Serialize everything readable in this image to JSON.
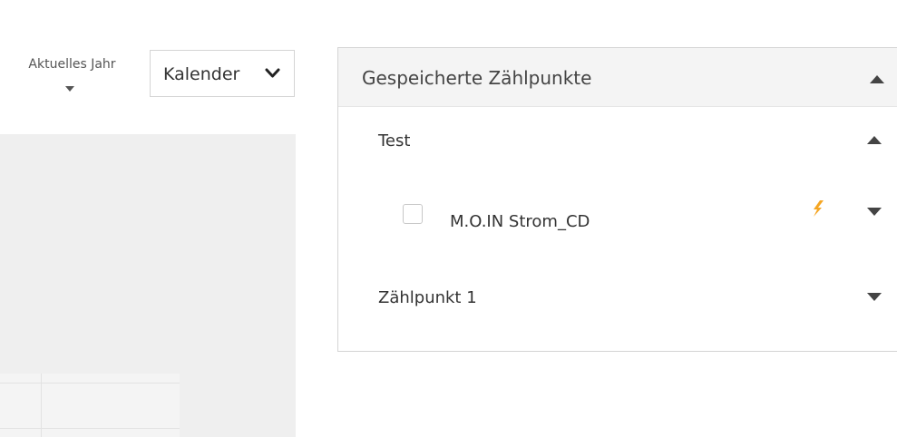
{
  "toolbar": {
    "period_label": "Aktuelles Jahr",
    "view_select_value": "Kalender"
  },
  "saved_points": {
    "title": "Gespeicherte Zählpunkte",
    "groups": [
      {
        "name": "Test",
        "expanded": true,
        "items": [
          {
            "name": "M.O.IN Strom_CD",
            "checked": false,
            "icon": "bolt-icon"
          }
        ]
      },
      {
        "name": "Zählpunkt 1",
        "expanded": false,
        "items": []
      }
    ]
  },
  "colors": {
    "panel_header_bg": "#f4f4f4",
    "chart_bg": "#efefef",
    "border": "#d4d4d4",
    "bolt": "#f5a623",
    "text": "#333333"
  }
}
